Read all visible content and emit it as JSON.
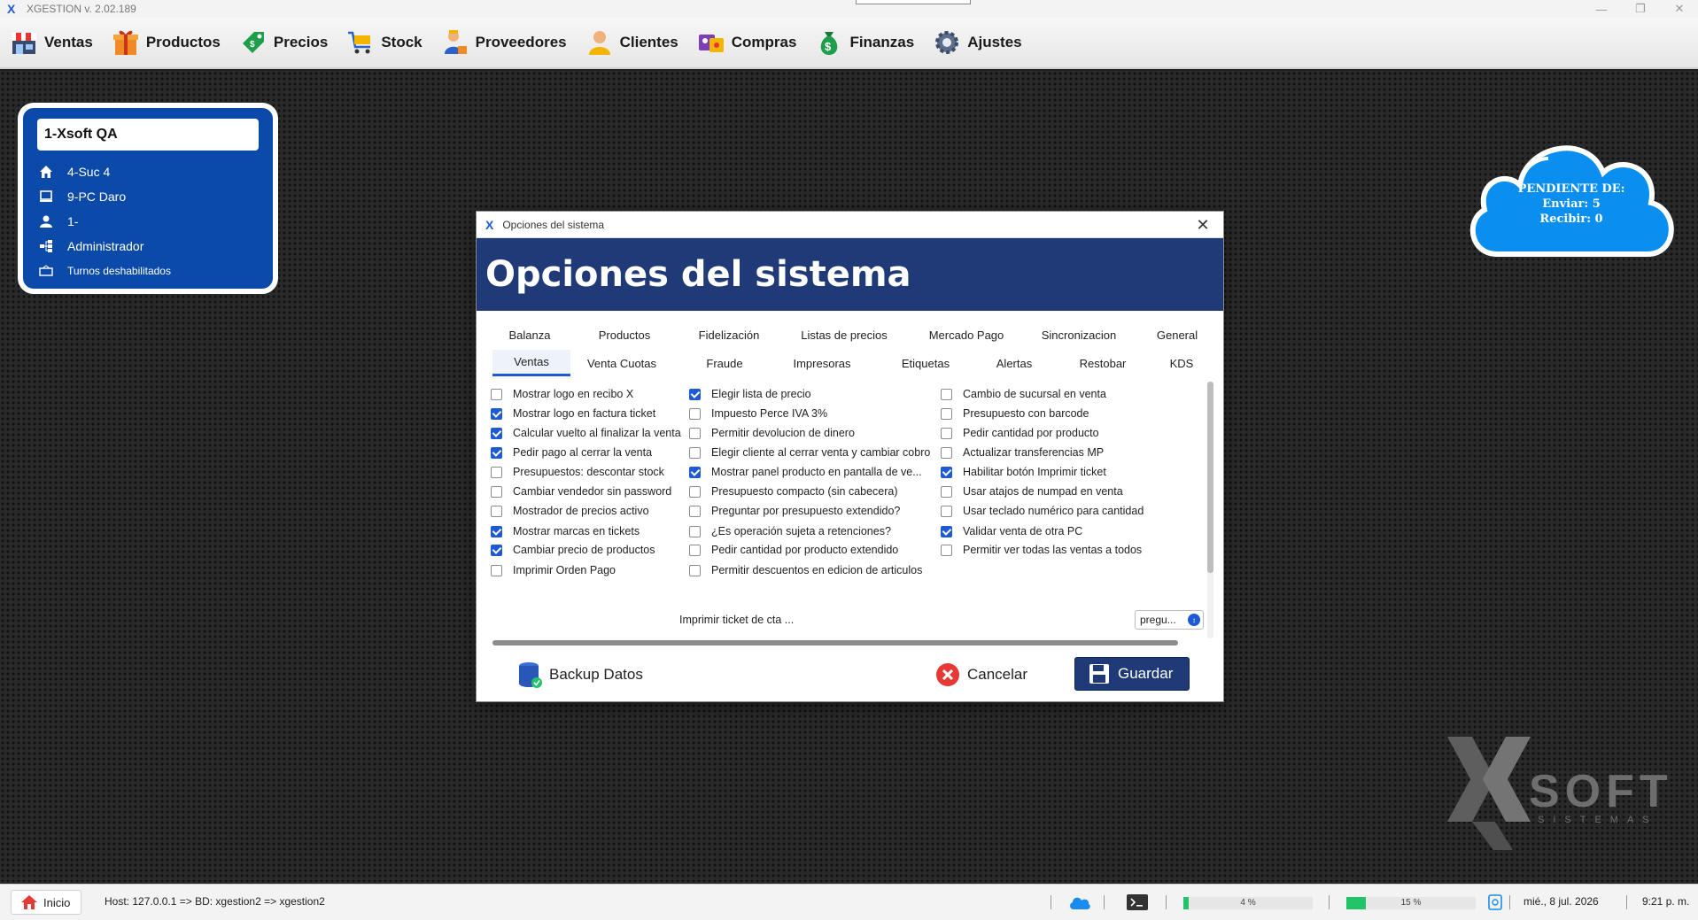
{
  "window": {
    "title": "XGESTION v. 2.02.189",
    "minimize_icon": "—",
    "restore_icon": "❐",
    "close_icon": "✕"
  },
  "menu": [
    {
      "label": "Ventas",
      "icon": "store-icon"
    },
    {
      "label": "Productos",
      "icon": "gift-box-icon"
    },
    {
      "label": "Precios",
      "icon": "price-tag-icon"
    },
    {
      "label": "Stock",
      "icon": "cart-icon"
    },
    {
      "label": "Proveedores",
      "icon": "supplier-icon"
    },
    {
      "label": "Clientes",
      "icon": "customer-icon"
    },
    {
      "label": "Compras",
      "icon": "shopping-bag-icon"
    },
    {
      "label": "Finanzas",
      "icon": "money-bag-icon"
    },
    {
      "label": "Ajustes",
      "icon": "gear-icon"
    }
  ],
  "info": {
    "company": "1-Xsoft QA",
    "branch": "4-Suc 4",
    "pc": "9-PC Daro",
    "user": "1-",
    "role": "Administrador",
    "shifts": "Turnos deshabilitados"
  },
  "sync": {
    "title": "PENDIENTE DE:",
    "send": "Enviar: 5",
    "receive": "Recibir: 0"
  },
  "watermark": {
    "word": "SOFT",
    "sub": "SISTEMAS"
  },
  "dialog": {
    "window_title": "Opciones del sistema",
    "heading": "Opciones del sistema",
    "close_label": "✕",
    "tabs_row1": [
      "Balanza",
      "Productos",
      "Fidelización",
      "Listas de precios",
      "Mercado Pago",
      "Sincronizacion",
      "General"
    ],
    "tabs_row2": [
      "Ventas",
      "Venta Cuotas",
      "Fraude",
      "Impresoras",
      "Etiquetas",
      "Alertas",
      "Restobar",
      "KDS"
    ],
    "active_tab": "Ventas",
    "col1": [
      {
        "label": "Mostrar logo en recibo X",
        "checked": false
      },
      {
        "label": "Mostrar logo en factura ticket",
        "checked": true
      },
      {
        "label": "Calcular vuelto al finalizar la venta",
        "checked": true
      },
      {
        "label": "Pedir pago al cerrar la venta",
        "checked": true
      },
      {
        "label": "Presupuestos: descontar stock",
        "checked": false
      },
      {
        "label": "Cambiar vendedor sin password",
        "checked": false
      },
      {
        "label": "Mostrador de precios activo",
        "checked": false
      },
      {
        "label": "Mostrar marcas en tickets",
        "checked": true
      },
      {
        "label": "Cambiar precio de productos",
        "checked": true
      },
      {
        "label": "Imprimir Orden Pago",
        "checked": false
      }
    ],
    "col2": [
      {
        "label": "Elegir lista de precio",
        "checked": true
      },
      {
        "label": "Impuesto Perce IVA 3%",
        "checked": false
      },
      {
        "label": "Permitir devolucion de dinero",
        "checked": false
      },
      {
        "label": "Elegir cliente al cerrar venta y cambiar cobro",
        "checked": false
      },
      {
        "label": "Mostrar panel producto en pantalla de ve...",
        "checked": true
      },
      {
        "label": "Presupuesto compacto (sin cabecera)",
        "checked": false
      },
      {
        "label": "Preguntar por presupuesto extendido?",
        "checked": false
      },
      {
        "label": "¿Es operación sujeta a retenciones?",
        "checked": false
      },
      {
        "label": "Pedir cantidad por producto extendido",
        "checked": false
      },
      {
        "label": "Permitir descuentos en edicion de articulos",
        "checked": false
      }
    ],
    "col3": [
      {
        "label": "Cambio de sucursal en venta",
        "checked": false
      },
      {
        "label": "Presupuesto con barcode",
        "checked": false
      },
      {
        "label": "Pedir cantidad por producto",
        "checked": false
      },
      {
        "label": "Actualizar transferencias MP",
        "checked": false
      },
      {
        "label": "Habilitar botón Imprimir ticket",
        "checked": true
      },
      {
        "label": "Usar atajos de numpad en venta",
        "checked": false
      },
      {
        "label": "Usar teclado numérico para cantidad",
        "checked": false
      },
      {
        "label": "Validar venta de otra PC",
        "checked": true
      },
      {
        "label": "Permitir ver todas las ventas a todos",
        "checked": false
      }
    ],
    "print_ticket_label": "Imprimir ticket de cta ...",
    "print_ticket_value": "pregu...",
    "buttons": {
      "backup": "Backup Datos",
      "cancel": "Cancelar",
      "save": "Guardar"
    }
  },
  "status": {
    "home": "Inicio",
    "host": "Host: 127.0.0.1 => BD: xgestion2 => xgestion2",
    "cpu_pct": "4 %",
    "cpu_value": 4,
    "mem_pct": "15 %",
    "mem_value": 15,
    "date": "mié., 8 jul. 2026",
    "time": "9:21 p. m."
  },
  "colors": {
    "accent": "#1e5ad6",
    "banner": "#1f3a76",
    "card": "#0b4aa8",
    "cloud": "#0a8ff0",
    "progress": "#22c46a",
    "cancel_red": "#e53935"
  }
}
